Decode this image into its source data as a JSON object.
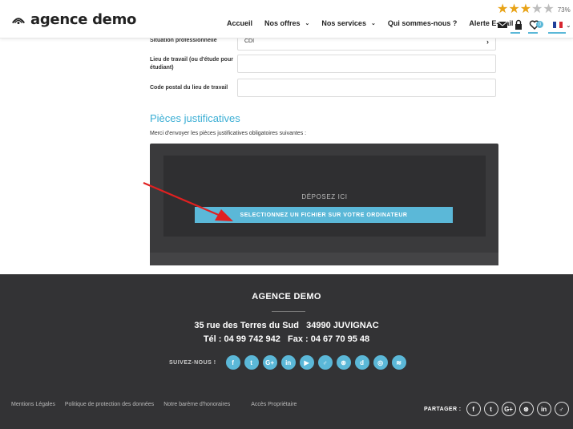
{
  "header": {
    "logo_text": "agence demo",
    "nav": [
      {
        "label": "Accueil",
        "caret": false
      },
      {
        "label": "Nos offres",
        "caret": true
      },
      {
        "label": "Nos services",
        "caret": true
      },
      {
        "label": "Qui sommes-nous ?",
        "caret": false
      },
      {
        "label": "Alerte E-mail",
        "caret": false
      }
    ],
    "rating": {
      "stars": 3,
      "max": 5,
      "percent_label": "73%"
    },
    "favorites_count": "0",
    "language_caret": "⌄"
  },
  "form": {
    "rows": [
      {
        "label": "Situation professionnelle",
        "value": "CDI",
        "type": "select"
      },
      {
        "label": "Lieu de travail (ou d'étude pour étudiant)",
        "value": "",
        "type": "text"
      },
      {
        "label": "Code postal du lieu de travail",
        "value": "",
        "type": "text"
      }
    ]
  },
  "uploads": {
    "title": "Pièces justificatives",
    "subtitle": "Merci d'envoyer les pièces justificatives obligatoires suivantes :",
    "drop_label": "DÉPOSEZ ICI",
    "select_button": "SELECTIONNEZ UN FICHIER SUR VOTRE ORDINATEUR"
  },
  "footer": {
    "title": "AGENCE DEMO",
    "address": "35 rue des Terres du Sud   34990 JUVIGNAC",
    "phone": "Tél : 04 99 742 942   Fax : 04 67 70 95 48",
    "follow_label": "SUIVEZ-NOUS !",
    "social": [
      {
        "glyph": "f",
        "icon": "facebook-icon"
      },
      {
        "glyph": "t",
        "icon": "twitter-icon"
      },
      {
        "glyph": "G+",
        "icon": "google-plus-icon"
      },
      {
        "glyph": "in",
        "icon": "linkedin-icon"
      },
      {
        "glyph": "▶",
        "icon": "youtube-icon"
      },
      {
        "glyph": "♂",
        "icon": "viadeo-icon"
      },
      {
        "glyph": "⊛",
        "icon": "pinterest-icon"
      },
      {
        "glyph": "d",
        "icon": "dailymotion-icon"
      },
      {
        "glyph": "◎",
        "icon": "instagram-icon"
      },
      {
        "glyph": "≋",
        "icon": "rss-icon"
      }
    ],
    "legal_links": [
      "Mentions Légales",
      "Politique de protection des données",
      "Notre barème d'honoraires",
      "Accès Propriétaire"
    ],
    "share_label": "PARTAGER :",
    "share": [
      {
        "glyph": "f",
        "icon": "facebook-icon"
      },
      {
        "glyph": "t",
        "icon": "twitter-icon"
      },
      {
        "glyph": "G+",
        "icon": "google-plus-icon"
      },
      {
        "glyph": "⊛",
        "icon": "pinterest-icon"
      },
      {
        "glyph": "in",
        "icon": "linkedin-icon"
      },
      {
        "glyph": "♂",
        "icon": "viadeo-icon"
      }
    ]
  },
  "colors": {
    "accent": "#5bb8d8",
    "title_blue": "#3aaed4",
    "footer_bg": "#333335",
    "star_filled": "#e8a317",
    "arrow": "#e02020"
  }
}
